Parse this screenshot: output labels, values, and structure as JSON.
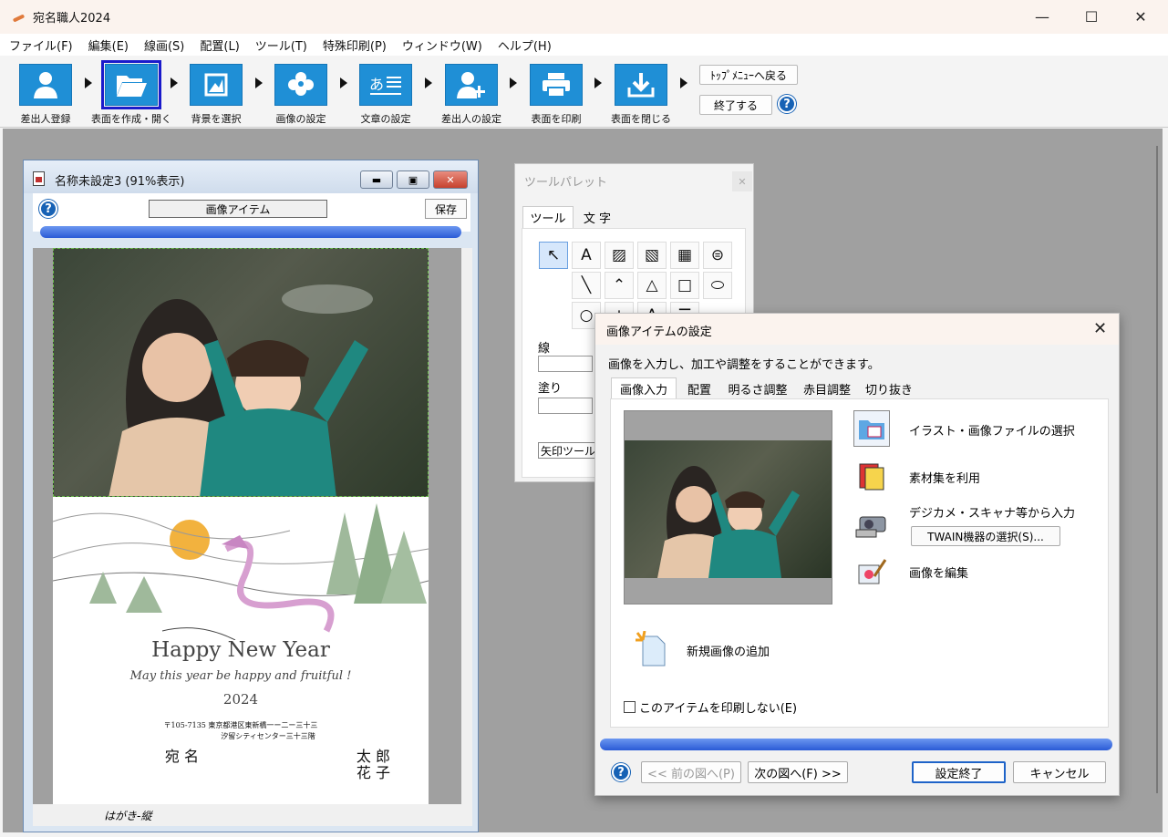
{
  "app": {
    "title": "宛名職人2024"
  },
  "window_controls": {
    "minimize": "—",
    "maximize": "☐",
    "close": "✕"
  },
  "menu": [
    "ファイル(F)",
    "編集(E)",
    "線画(S)",
    "配置(L)",
    "ツール(T)",
    "特殊印刷(P)",
    "ウィンドウ(W)",
    "ヘルプ(H)"
  ],
  "toolbar": {
    "items": [
      {
        "label": "差出人登録",
        "icon": "person-icon"
      },
      {
        "label": "表面を作成・開く",
        "icon": "folder-open-icon"
      },
      {
        "label": "背景を選択",
        "icon": "picture-icon"
      },
      {
        "label": "画像の設定",
        "icon": "flower-icon"
      },
      {
        "label": "文章の設定",
        "icon": "text-icon"
      },
      {
        "label": "差出人の設定",
        "icon": "add-person-icon"
      },
      {
        "label": "表面を印刷",
        "icon": "printer-icon"
      },
      {
        "label": "表面を閉じる",
        "icon": "download-icon"
      }
    ],
    "top_menu": "ﾄｯﾌﾟﾒﾆｭｰへ戻る",
    "quit": "終了する",
    "help": "?"
  },
  "doc": {
    "title": "名称未設定3 (91%表示)",
    "item_label": "画像アイテム",
    "save": "保存",
    "help": "?",
    "card": {
      "greeting": "Happy New Year",
      "message": "May this year be happy and fruitful !",
      "year": "2024",
      "address1": "〒105-7135 東京都港区東新橋一ー二ー三十三",
      "address2": "汐留シティセンター三十三階",
      "name_family": "宛 名",
      "name_given1": "太 郎",
      "name_given2": "花 子"
    },
    "paper_label": "はがき-縦"
  },
  "palette": {
    "title": "ツールパレット",
    "close": "✕",
    "tabs": [
      "ツール",
      "文 字"
    ],
    "line_label": "線",
    "fill_label": "塗り",
    "tool_name": "矢印ツール"
  },
  "dialog": {
    "title": "画像アイテムの設定",
    "close": "✕",
    "intro": "画像を入力し、加工や調整をすることができます。",
    "tabs": [
      "画像入力",
      "配置",
      "明るさ調整",
      "赤目調整",
      "切り抜き"
    ],
    "options": {
      "file_select": "イラスト・画像ファイルの選択",
      "materials": "素材集を利用",
      "camera": "デジカメ・スキャナ等から入力",
      "twain": "TWAIN機器の選択(S)...",
      "edit": "画像を編集",
      "new_image": "新規画像の追加"
    },
    "no_print": "このアイテムを印刷しない(E)",
    "buttons": {
      "help": "?",
      "prev": "<< 前の図へ(P)",
      "next": "次の図へ(F) >>",
      "done": "設定終了",
      "cancel": "キャンセル"
    }
  }
}
